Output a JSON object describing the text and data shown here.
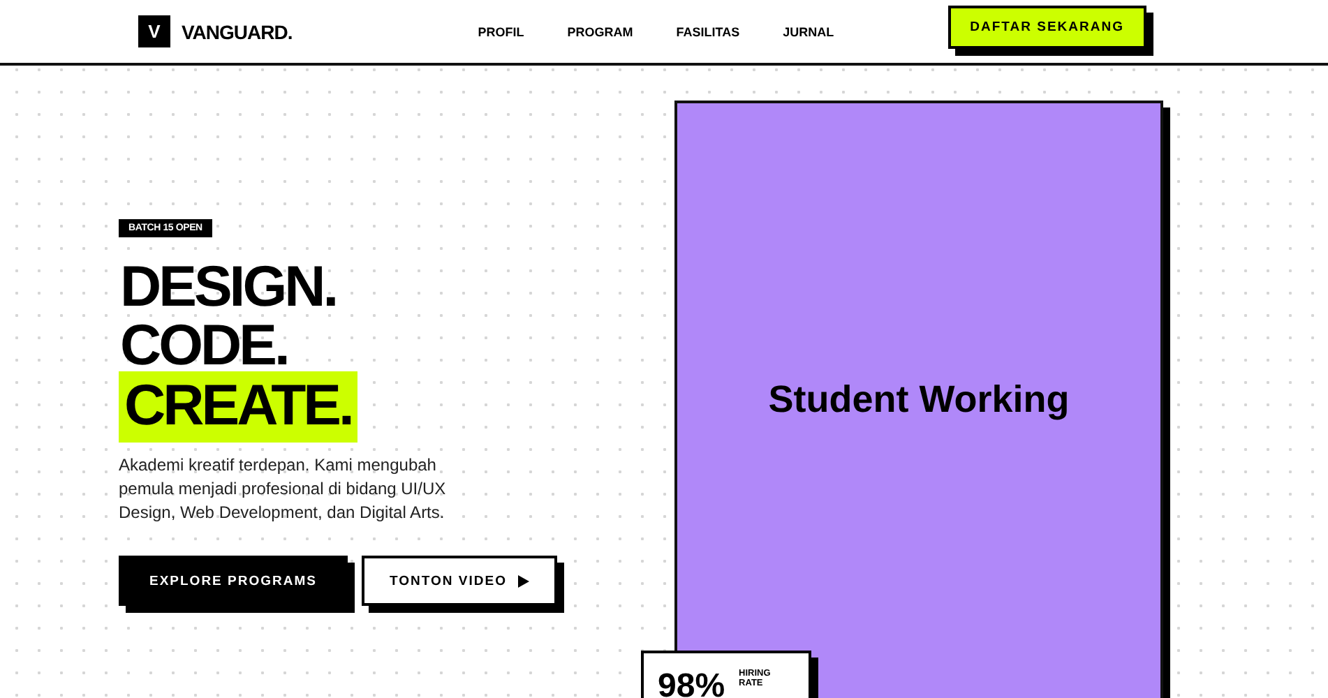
{
  "header": {
    "logo_mark": "V",
    "logo_text": "VANGUARD.",
    "nav": [
      {
        "label": "PROFIL"
      },
      {
        "label": "PROGRAM"
      },
      {
        "label": "FASILITAS"
      },
      {
        "label": "JURNAL"
      }
    ],
    "cta": "DAFTAR SEKARANG"
  },
  "hero": {
    "badge": "BATCH 15 OPEN",
    "headline": [
      {
        "text": "DESIGN.",
        "highlighted": false
      },
      {
        "text": "CODE.",
        "highlighted": false
      },
      {
        "text": "CREATE.",
        "highlighted": true
      }
    ],
    "description": "Akademi kreatif terdepan. Kami mengubah pemula menjadi profesional di bidang UI/UX Design, Web Development, dan Digital Arts.",
    "buttons": [
      {
        "label": "EXPLORE PROGRAMS",
        "kind": "primary"
      },
      {
        "label": "TONTON VIDEO",
        "kind": "video"
      }
    ]
  },
  "image_card": {
    "caption": "Student Working"
  },
  "stat": {
    "value": "98%",
    "label": "HIRING RATE"
  }
}
